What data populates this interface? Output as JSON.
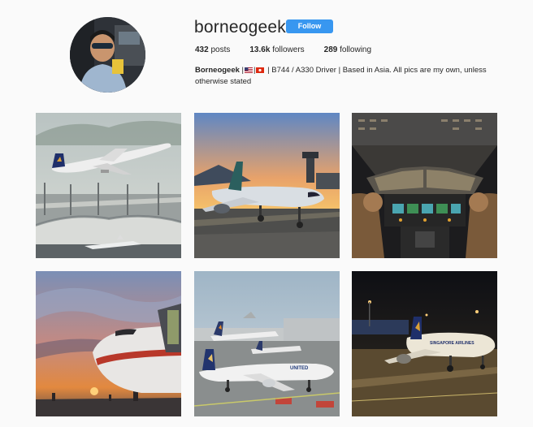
{
  "profile": {
    "username": "borneogeek",
    "follow_label": "Follow",
    "stats": [
      {
        "count": "432",
        "label": "posts"
      },
      {
        "count": "13.6k",
        "label": "followers"
      },
      {
        "count": "289",
        "label": "following"
      }
    ],
    "bio_name": "Borneogeek",
    "bio_sep1": " |",
    "bio_sep2": "|",
    "bio_text": " | B744 / A330 Driver | Based in Asia. All pics are my own, unless otherwise stated"
  },
  "posts": [
    {
      "icon": "post-1"
    },
    {
      "icon": "post-2"
    },
    {
      "icon": "post-3"
    },
    {
      "icon": "post-4"
    },
    {
      "icon": "post-5"
    },
    {
      "icon": "post-6"
    }
  ],
  "colors": {
    "follow_button": "#3897f0",
    "background": "#fafafa",
    "text": "#262626"
  }
}
